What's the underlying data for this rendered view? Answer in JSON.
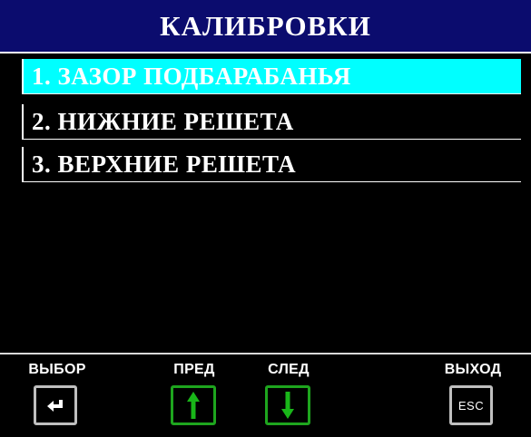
{
  "header": {
    "title": "КАЛИБРОВКИ"
  },
  "menu": {
    "items": [
      {
        "label": "1. ЗАЗОР ПОДБАРАБАНЬЯ",
        "selected": true
      },
      {
        "label": "2. НИЖНИЕ РЕШЕТА",
        "selected": false
      },
      {
        "label": "3. ВЕРХНИЕ РЕШЕТА",
        "selected": false
      }
    ]
  },
  "softkeys": {
    "select": {
      "caption": "ВЫБОР",
      "icon": "enter-icon"
    },
    "prev": {
      "caption": "ПРЕД",
      "icon": "arrow-up-icon"
    },
    "next": {
      "caption": "СЛЕД",
      "icon": "arrow-down-icon"
    },
    "exit": {
      "caption": "ВЫХОД",
      "icon": "esc-icon",
      "icon_text": "ESC"
    }
  },
  "colors": {
    "title_bg": "#0b0c6e",
    "selected_bg": "#00ffff",
    "nav_button_border": "#1ea51e",
    "arrow_green": "#19b619"
  }
}
